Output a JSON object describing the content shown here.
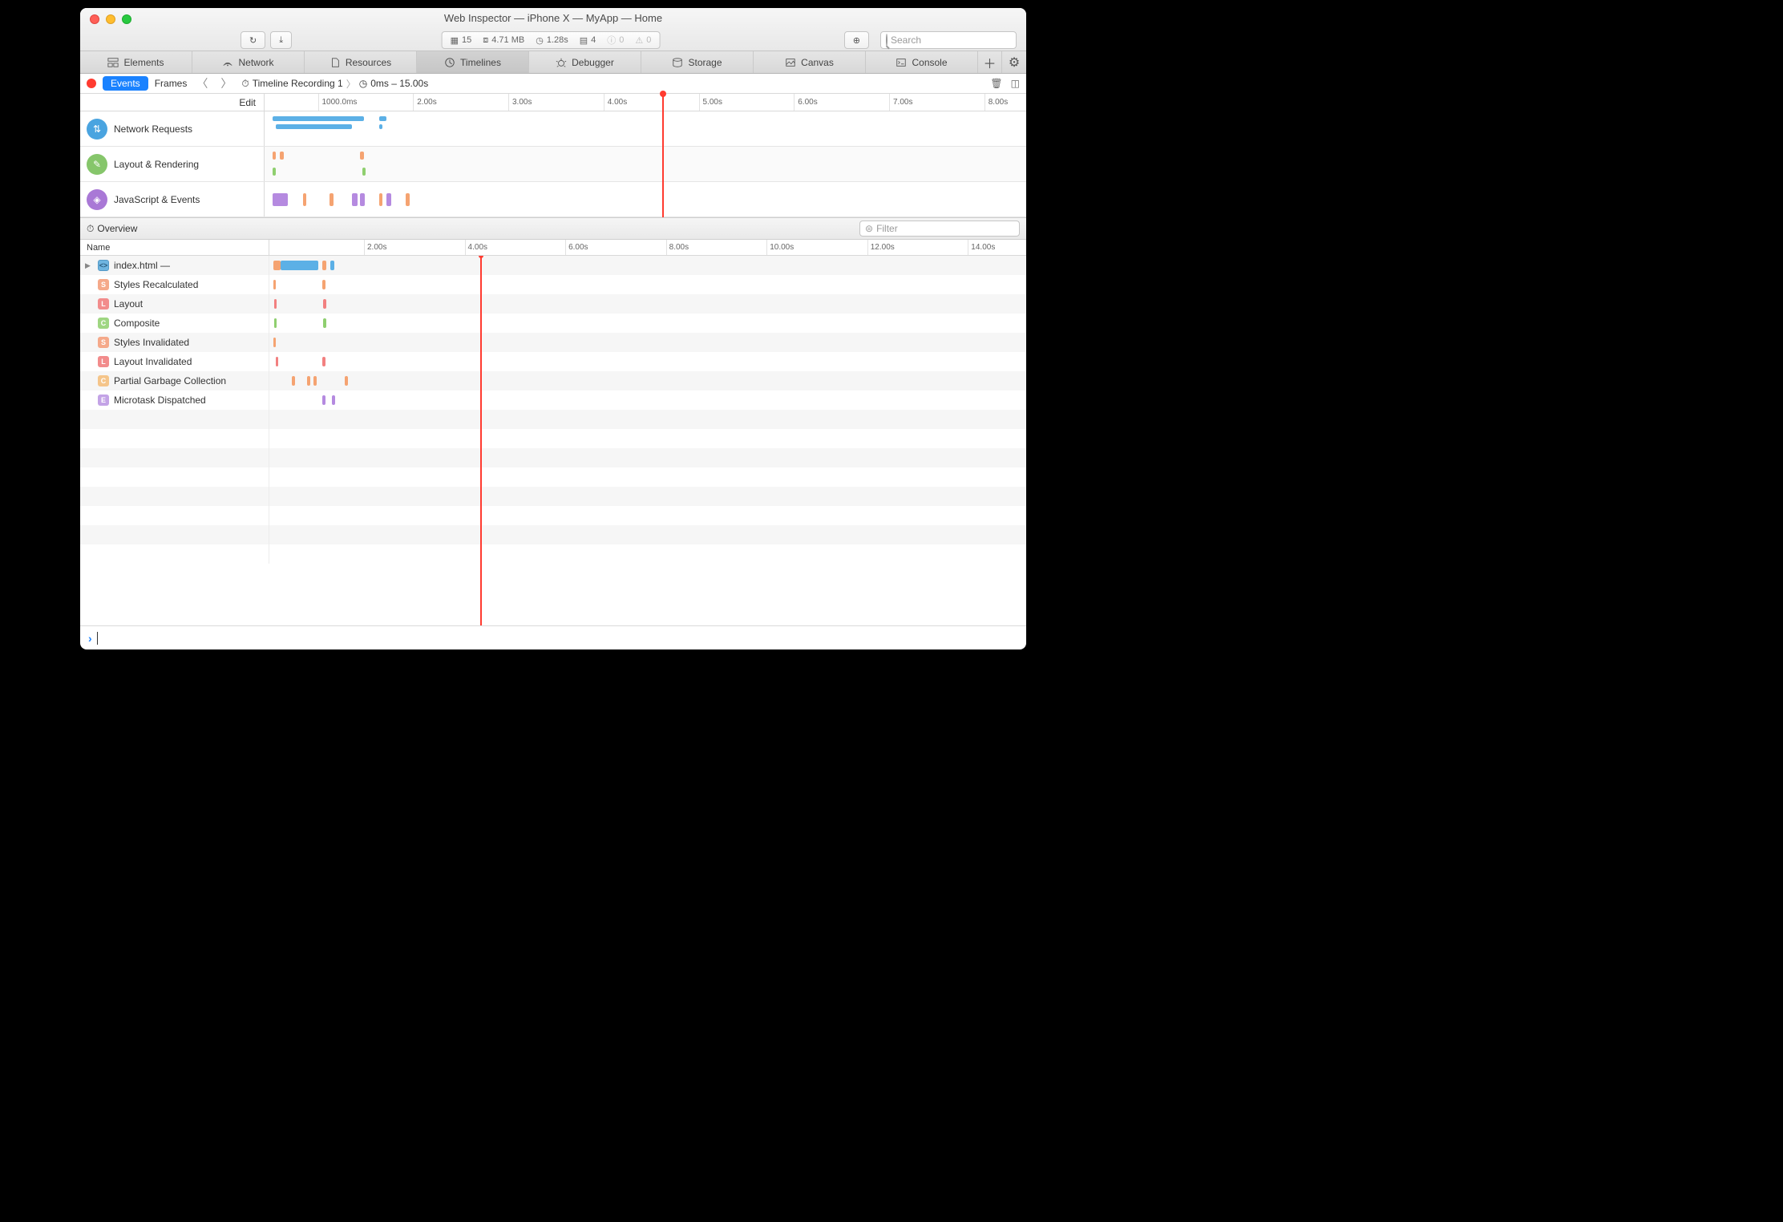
{
  "window": {
    "title": "Web Inspector — iPhone X — MyApp — Home"
  },
  "toolbar": {
    "stats": {
      "docs": "15",
      "size": "4.71 MB",
      "time": "1.28s",
      "msgs": "4",
      "err": "0",
      "warn": "0"
    },
    "search_placeholder": "Search"
  },
  "tabs": {
    "elements": "Elements",
    "network": "Network",
    "resources": "Resources",
    "timelines": "Timelines",
    "debugger": "Debugger",
    "storage": "Storage",
    "canvas": "Canvas",
    "console": "Console"
  },
  "subbar": {
    "events": "Events",
    "frames": "Frames",
    "recording": "Timeline Recording 1",
    "range": "0ms – 15.00s"
  },
  "ruler_top": {
    "edit": "Edit",
    "ticks": [
      "1000.0ms",
      "2.00s",
      "3.00s",
      "4.00s",
      "5.00s",
      "6.00s",
      "7.00s",
      "8.00s"
    ]
  },
  "tracks": {
    "network": "Network Requests",
    "layout": "Layout & Rendering",
    "js": "JavaScript & Events"
  },
  "overview": {
    "label": "Overview",
    "filter_placeholder": "Filter"
  },
  "details": {
    "name_header": "Name",
    "ticks": [
      "2.00s",
      "4.00s",
      "6.00s",
      "8.00s",
      "10.00s",
      "12.00s",
      "14.00s"
    ],
    "rows": [
      {
        "icon": "H",
        "label": "index.html —",
        "disclosure": true
      },
      {
        "icon": "S",
        "label": "Styles Recalculated"
      },
      {
        "icon": "L",
        "label": "Layout"
      },
      {
        "icon": "C",
        "label": "Composite"
      },
      {
        "icon": "S",
        "label": "Styles Invalidated"
      },
      {
        "icon": "L",
        "label": "Layout Invalidated"
      },
      {
        "icon": "Co",
        "label": "Partial Garbage Collection"
      },
      {
        "icon": "E",
        "label": "Microtask Dispatched"
      }
    ]
  },
  "chart_data": {
    "type": "timeline",
    "overview_range_s": [
      0,
      8
    ],
    "detail_range_s": [
      0,
      15
    ],
    "playhead_s": 3.35,
    "tracks": {
      "network": [
        {
          "start": 0.05,
          "end": 1.1
        },
        {
          "start": 0.1,
          "end": 0.95
        },
        {
          "start": 1.22,
          "end": 1.3
        }
      ],
      "layout_rendering": [
        {
          "kind": "orange",
          "t": 0.05
        },
        {
          "kind": "orange",
          "t": 0.12
        },
        {
          "kind": "green",
          "t": 0.05
        },
        {
          "kind": "orange",
          "t": 1.0
        },
        {
          "kind": "green",
          "t": 1.05
        }
      ],
      "javascript": [
        {
          "kind": "purple",
          "start": 0.05,
          "end": 0.18
        },
        {
          "kind": "orange",
          "t": 0.4
        },
        {
          "kind": "orange",
          "t": 0.7
        },
        {
          "kind": "purple",
          "t": 0.95
        },
        {
          "kind": "purple",
          "t": 1.0
        },
        {
          "kind": "orange",
          "t": 1.25
        },
        {
          "kind": "purple",
          "t": 1.3
        },
        {
          "kind": "orange",
          "t": 1.5
        }
      ]
    },
    "details": {
      "index_html": [
        {
          "color": "orange",
          "start": 0.05,
          "end": 0.15
        },
        {
          "color": "blue",
          "start": 0.15,
          "end": 0.9
        },
        {
          "color": "orange",
          "t": 1.0
        },
        {
          "color": "blue",
          "t": 1.15
        }
      ],
      "styles_recalculated": [
        {
          "t": 0.05
        },
        {
          "t": 1.0
        }
      ],
      "layout": [
        {
          "t": 0.07
        },
        {
          "t": 1.02
        }
      ],
      "composite": [
        {
          "t": 0.07
        },
        {
          "t": 1.02
        }
      ],
      "styles_invalidated": [
        {
          "t": 0.05
        }
      ],
      "layout_invalidated": [
        {
          "t": 0.1
        },
        {
          "t": 1.0
        }
      ],
      "partial_gc": [
        {
          "t": 0.4
        },
        {
          "t": 0.75
        },
        {
          "t": 0.85
        },
        {
          "t": 1.45
        }
      ],
      "microtask_dispatched": [
        {
          "t": 1.0
        },
        {
          "t": 1.2
        }
      ]
    }
  }
}
